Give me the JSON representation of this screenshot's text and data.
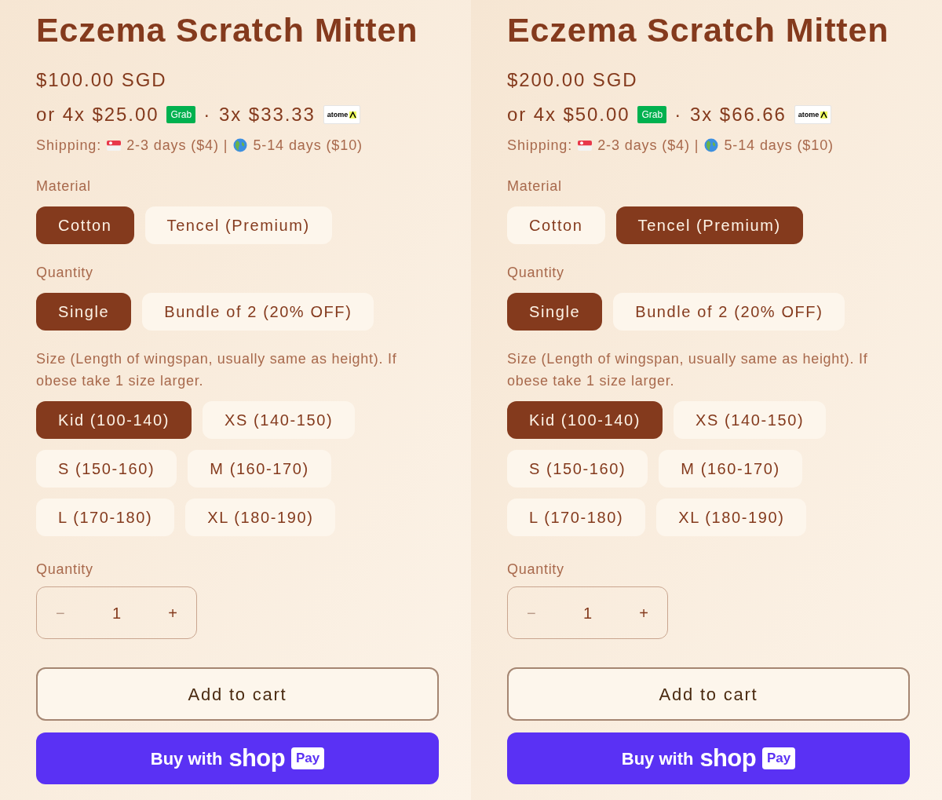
{
  "panels": [
    {
      "title": "Eczema Scratch Mitten",
      "price": "$100.00 SGD",
      "installments": {
        "grab_text": "or 4x $25.00",
        "grab_badge": "Grab",
        "separator": "·",
        "atome_text": "3x $33.33",
        "atome_badge": "atome"
      },
      "shipping": {
        "label": "Shipping:",
        "local": "2-3 days ($4) |",
        "international": "5-14 days ($10)"
      },
      "option_groups": [
        {
          "label": "Material",
          "options": [
            {
              "label": "Cotton",
              "selected": true
            },
            {
              "label": "Tencel (Premium)",
              "selected": false
            }
          ]
        },
        {
          "label": "Quantity",
          "options": [
            {
              "label": "Single",
              "selected": true
            },
            {
              "label": "Bundle of 2 (20% OFF)",
              "selected": false
            }
          ]
        },
        {
          "label": "Size (Length of wingspan, usually same as height). If obese take 1 size larger.",
          "options": [
            {
              "label": "Kid (100-140)",
              "selected": true
            },
            {
              "label": "XS (140-150)",
              "selected": false
            },
            {
              "label": "S (150-160)",
              "selected": false
            },
            {
              "label": "M (160-170)",
              "selected": false
            },
            {
              "label": "L (170-180)",
              "selected": false
            },
            {
              "label": "XL (180-190)",
              "selected": false
            }
          ]
        }
      ],
      "quantity": {
        "label": "Quantity",
        "decrement": "−",
        "value": "1",
        "increment": "+"
      },
      "add_to_cart": "Add to cart",
      "shop_pay": {
        "prefix": "Buy with",
        "brand": "shop",
        "badge": "Pay"
      }
    },
    {
      "title": "Eczema Scratch Mitten",
      "price": "$200.00 SGD",
      "installments": {
        "grab_text": "or 4x $50.00",
        "grab_badge": "Grab",
        "separator": "·",
        "atome_text": "3x $66.66",
        "atome_badge": "atome"
      },
      "shipping": {
        "label": "Shipping:",
        "local": "2-3 days ($4) |",
        "international": "5-14 days ($10)"
      },
      "option_groups": [
        {
          "label": "Material",
          "options": [
            {
              "label": "Cotton",
              "selected": false
            },
            {
              "label": "Tencel (Premium)",
              "selected": true
            }
          ]
        },
        {
          "label": "Quantity",
          "options": [
            {
              "label": "Single",
              "selected": true
            },
            {
              "label": "Bundle of 2 (20% OFF)",
              "selected": false
            }
          ]
        },
        {
          "label": "Size (Length of wingspan, usually same as height). If obese take 1 size larger.",
          "options": [
            {
              "label": "Kid (100-140)",
              "selected": true
            },
            {
              "label": "XS (140-150)",
              "selected": false
            },
            {
              "label": "S (150-160)",
              "selected": false
            },
            {
              "label": "M (160-170)",
              "selected": false
            },
            {
              "label": "L (170-180)",
              "selected": false
            },
            {
              "label": "XL (180-190)",
              "selected": false
            }
          ]
        }
      ],
      "quantity": {
        "label": "Quantity",
        "decrement": "−",
        "value": "1",
        "increment": "+"
      },
      "add_to_cart": "Add to cart",
      "shop_pay": {
        "prefix": "Buy with",
        "brand": "shop",
        "badge": "Pay"
      }
    }
  ]
}
